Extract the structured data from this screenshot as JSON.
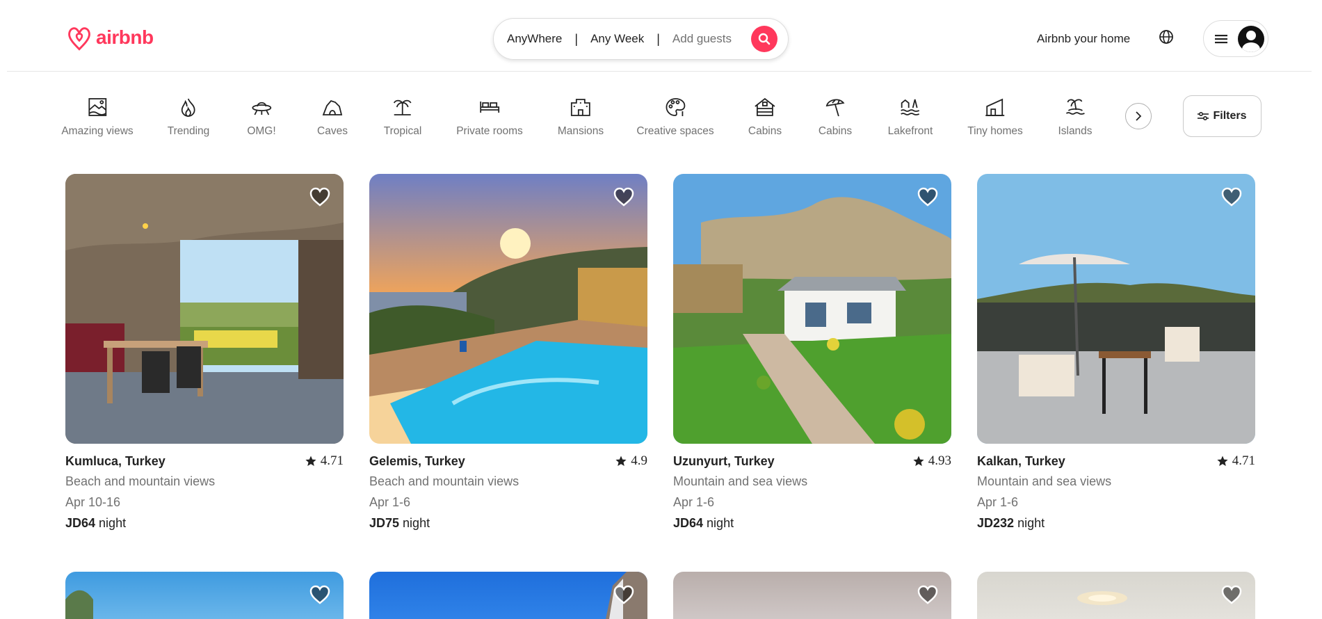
{
  "brand": {
    "name": "airbnb",
    "color": "#ff385c"
  },
  "search": {
    "where": "AnyWhere",
    "when": "Any Week",
    "guests": "Add guests",
    "separator": "|"
  },
  "header": {
    "host_link": "Airbnb your home"
  },
  "categories": [
    {
      "label": "Amazing views",
      "icon": "amazing-views-icon"
    },
    {
      "label": "Trending",
      "icon": "flame-icon"
    },
    {
      "label": "OMG!",
      "icon": "ufo-icon"
    },
    {
      "label": "Caves",
      "icon": "cave-icon"
    },
    {
      "label": "Tropical",
      "icon": "palm-tree-icon"
    },
    {
      "label": "Private rooms",
      "icon": "bed-icon"
    },
    {
      "label": "Mansions",
      "icon": "mansion-icon"
    },
    {
      "label": "Creative spaces",
      "icon": "palette-icon"
    },
    {
      "label": "Cabins",
      "icon": "cabin-icon"
    },
    {
      "label": "Cabins",
      "icon": "beach-umbrella-icon"
    },
    {
      "label": "Lakefront",
      "icon": "lakefront-icon"
    },
    {
      "label": "Tiny homes",
      "icon": "tiny-home-icon"
    },
    {
      "label": "Islands",
      "icon": "island-icon"
    }
  ],
  "filters_label": "Filters",
  "listings": [
    {
      "location": "Kumluca, Turkey",
      "rating": "4.71",
      "description": "Beach and mountain views",
      "dates": "Apr 10-16",
      "price": "JD64",
      "price_unit": "night"
    },
    {
      "location": "Gelemis, Turkey",
      "rating": "4.9",
      "description": "Beach and mountain views",
      "dates": "Apr 1-6",
      "price": "JD75",
      "price_unit": "night"
    },
    {
      "location": "Uzunyurt, Turkey",
      "rating": "4.93",
      "description": "Mountain and sea views",
      "dates": "Apr 1-6",
      "price": "JD64",
      "price_unit": "night"
    },
    {
      "location": "Kalkan, Turkey",
      "rating": "4.71",
      "description": "Mountain and sea views",
      "dates": "Apr 1-6",
      "price": "JD232",
      "price_unit": "night"
    }
  ]
}
